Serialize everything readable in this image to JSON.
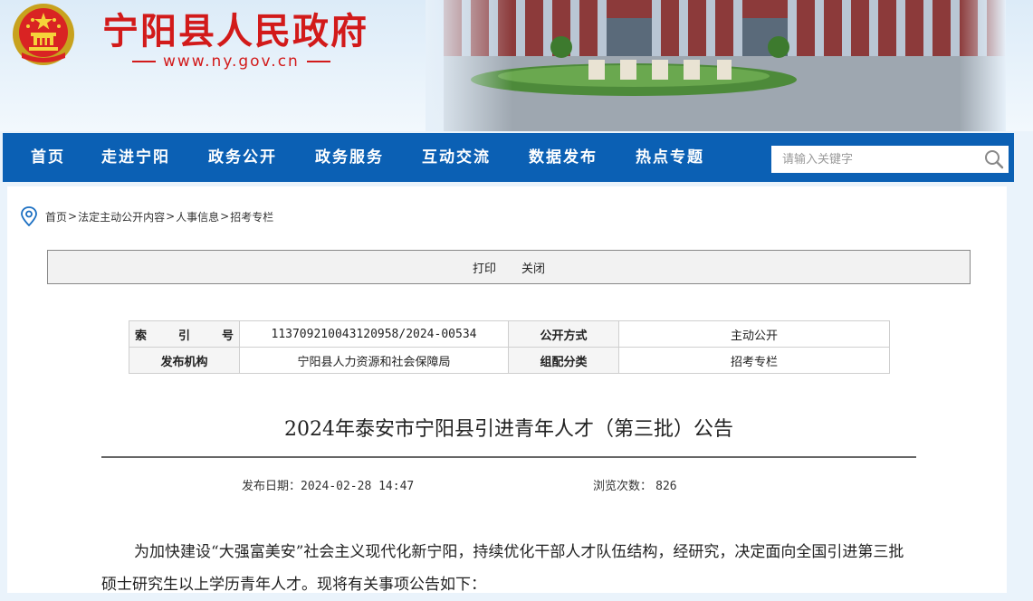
{
  "header": {
    "site_title": "宁阳县人民政府",
    "site_url": "www.ny.gov.cn",
    "accent_color": "#d21a1a"
  },
  "nav": {
    "items": [
      "首页",
      "走进宁阳",
      "政务公开",
      "政务服务",
      "互动交流",
      "数据发布",
      "热点专题"
    ],
    "search_placeholder": "请输入关键字",
    "background": "#0b60b4"
  },
  "breadcrumb": {
    "items": [
      "首页",
      "法定主动公开内容",
      "人事信息",
      "招考专栏"
    ],
    "separator": ">"
  },
  "toolbar": {
    "print": "打印",
    "close": "关闭"
  },
  "meta": {
    "index_label_chars": [
      "索",
      "引",
      "号"
    ],
    "index_value": "11370921004312095​8/2024-00534",
    "open_mode_label": "公开方式",
    "open_mode_value": "主动公开",
    "publisher_label": "发布机构",
    "publisher_value": "宁阳县人力资源和社会保障局",
    "category_label": "组配分类",
    "category_value": "招考专栏"
  },
  "article": {
    "title": "2024年泰安市宁阳县引进青年人才（第三批）公告",
    "date_label": "发布日期：",
    "date_value": "2024-02-28 14:47",
    "views_label": "浏览次数：",
    "views_value": "826",
    "paragraph": "为加快建设“大强富美安”社会主义现代化新宁阳，持续优化干部人才队伍结构，经研究，决定面向全国引进第三批硕士研究生以上学历青年人才。现将有关事项公告如下："
  }
}
